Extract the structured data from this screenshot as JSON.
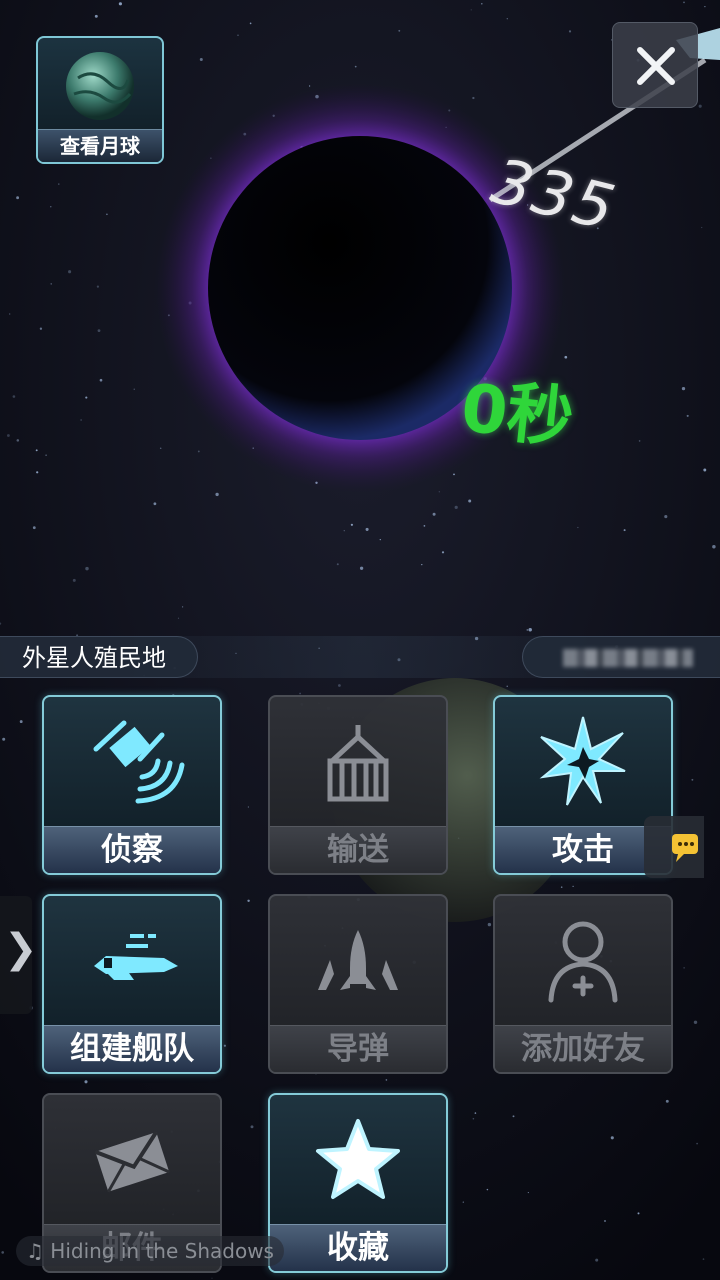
{
  "top": {
    "view_moon_label": "查看月球",
    "distance_value": "335",
    "timer_text": "0秒"
  },
  "planet": {
    "name": "外星人殖民地",
    "owner_name": ""
  },
  "actions": [
    {
      "label": "侦察",
      "icon": "satellite-icon",
      "enabled": true
    },
    {
      "label": "输送",
      "icon": "cargo-crate-icon",
      "enabled": false
    },
    {
      "label": "攻击",
      "icon": "explosion-icon",
      "enabled": true
    },
    {
      "label": "组建舰队",
      "icon": "spaceship-icon",
      "enabled": true
    },
    {
      "label": "导弹",
      "icon": "missile-icon",
      "enabled": false
    },
    {
      "label": "添加好友",
      "icon": "add-friend-icon",
      "enabled": false
    },
    {
      "label": "邮件",
      "icon": "mail-icon",
      "enabled": false
    },
    {
      "label": "收藏",
      "icon": "star-icon",
      "enabled": true
    }
  ],
  "music": {
    "now_playing": "♫ Hiding in the Shadows"
  },
  "colors": {
    "active_border": "#84cbd8",
    "timer_green": "#2fd63a",
    "planet_glow": "#7a2fd0"
  }
}
